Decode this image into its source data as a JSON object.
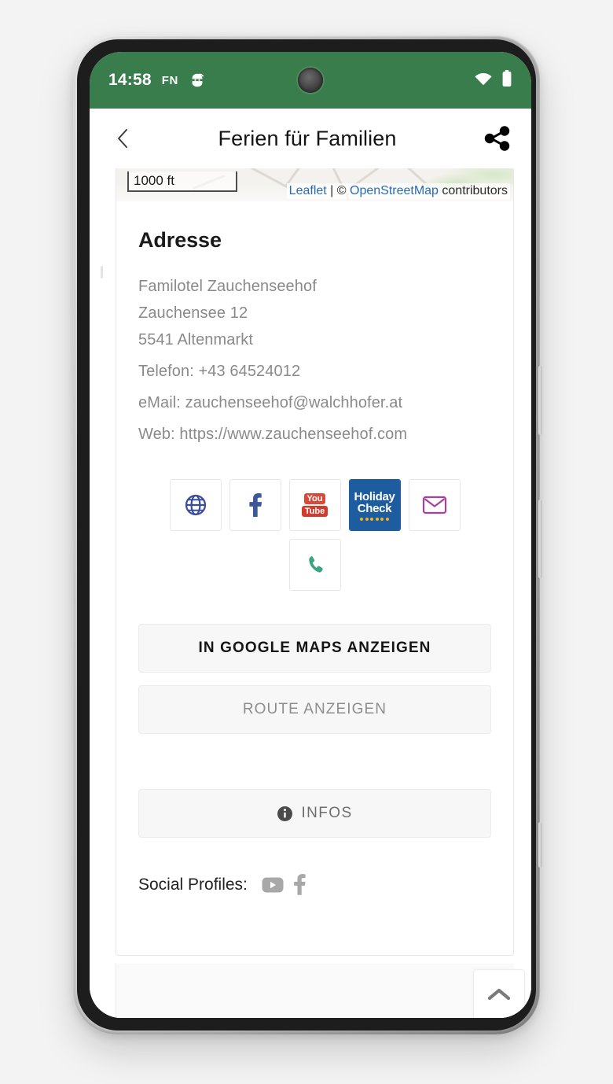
{
  "status_bar": {
    "time": "14:58",
    "carrier": "FN",
    "app_icon_name": "app-notification-icon",
    "wifi_icon_name": "wifi-icon",
    "battery_icon_name": "battery-icon"
  },
  "app_bar": {
    "back_label": "Zurück",
    "title": "Ferien für Familien",
    "share_label": "Teilen"
  },
  "map": {
    "scale_label": "1000 ft",
    "attribution_leaflet": "Leaflet",
    "attribution_separator": " | © ",
    "attribution_osm": "OpenStreetMap",
    "attribution_suffix": " contributors"
  },
  "address": {
    "heading": "Adresse",
    "lines": [
      "Familotel Zauchenseehof",
      "Zauchensee 12",
      "5541 Altenmarkt"
    ],
    "phone": "Telefon: +43 64524012",
    "email": "eMail: zauchenseehof@walchhofer.at",
    "web": "Web: https://www.zauchenseehof.com"
  },
  "icon_buttons": [
    {
      "name": "website-icon-button",
      "icon": "globe-icon",
      "color": "#3b4c9a"
    },
    {
      "name": "facebook-icon-button",
      "icon": "facebook-icon",
      "color": "#3b5998"
    },
    {
      "name": "youtube-icon-button",
      "icon": "youtube-icon",
      "top_text": "You",
      "bottom_text": "Tube",
      "color": "#d94a3a"
    },
    {
      "name": "holidaycheck-icon-button",
      "icon": "holidaycheck-logo",
      "line1": "Holiday",
      "line2": "Check",
      "color": "#1d5c9e",
      "dot_color": "#f0b323"
    },
    {
      "name": "email-icon-button",
      "icon": "envelope-icon",
      "color": "#a9409b"
    },
    {
      "name": "phone-icon-button",
      "icon": "phone-icon",
      "color": "#3aa57e"
    }
  ],
  "actions": {
    "google_maps": "IN GOOGLE MAPS ANZEIGEN",
    "route": "ROUTE ANZEIGEN",
    "infos": "INFOS",
    "infos_icon": "info-circle-icon"
  },
  "social": {
    "label": "Social Profiles:",
    "profiles": [
      {
        "name": "youtube-profile-icon",
        "icon": "youtube-icon"
      },
      {
        "name": "facebook-profile-icon",
        "icon": "facebook-icon"
      }
    ]
  },
  "fab": {
    "name": "scroll-to-top-button",
    "icon": "chevron-up-icon"
  },
  "nav_bar": {
    "gesture_pill": "home-gesture-pill"
  },
  "colors": {
    "status_bar_green": "#3a7d4c",
    "page_background": "#f3f3f3",
    "button_surface": "#f7f7f7"
  }
}
